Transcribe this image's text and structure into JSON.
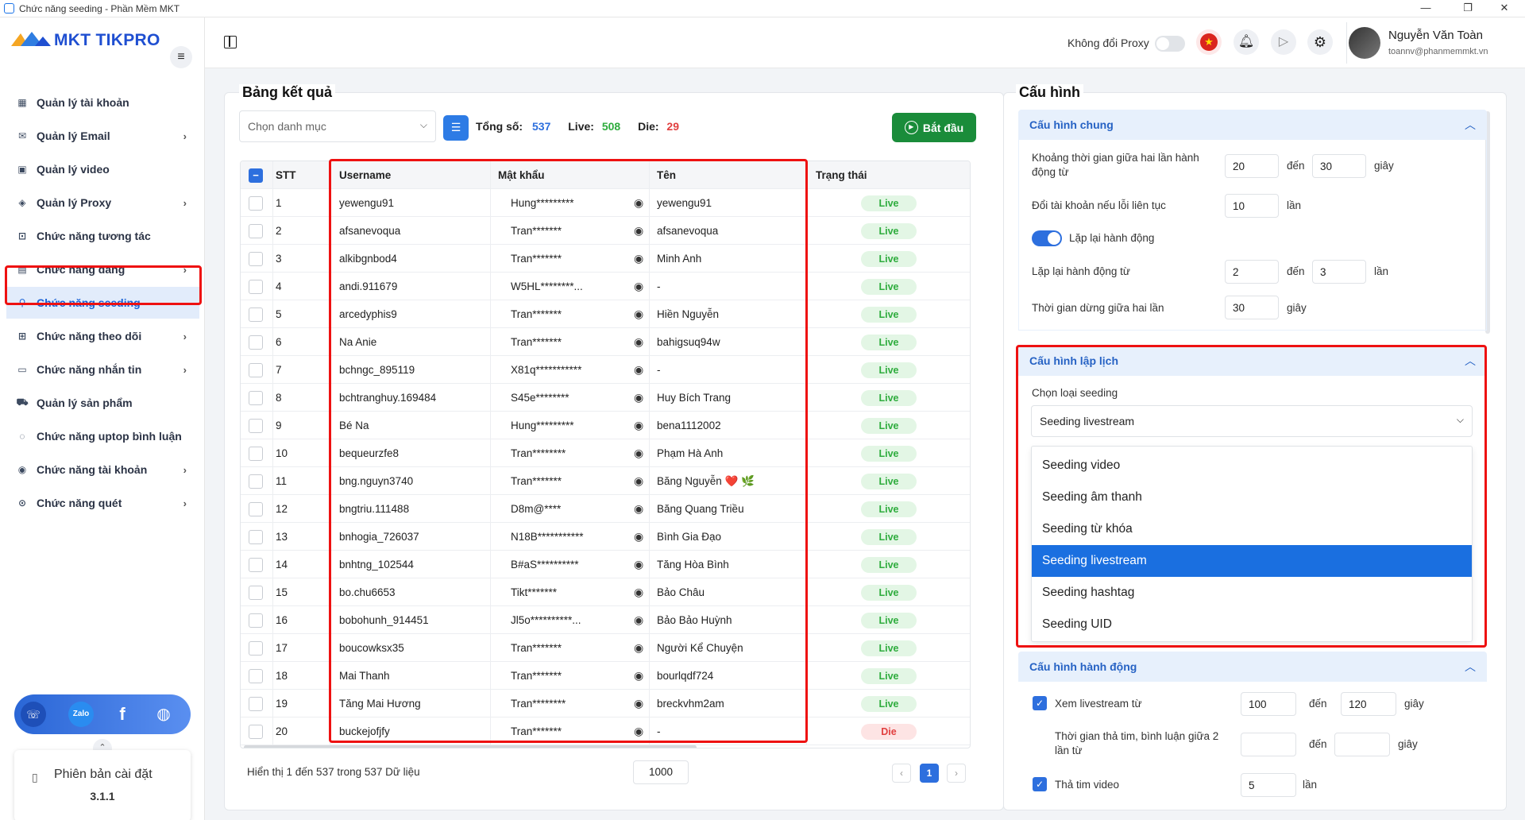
{
  "window": {
    "title": "Chức năng seeding - Phần Mềm MKT",
    "minimize": "—",
    "maximize": "❐",
    "close": "✕"
  },
  "app": {
    "logo_text": "MKT TIKPRO",
    "version_label": "Phiên bản cài đặt",
    "version": "3.1.1"
  },
  "sidebar": {
    "items": [
      {
        "label": "Quản lý tài khoản",
        "icon": "grid-icon",
        "glyph": "▦",
        "chevron": false
      },
      {
        "label": "Quản lý Email",
        "icon": "mail-icon",
        "glyph": "✉",
        "chevron": true
      },
      {
        "label": "Quản lý video",
        "icon": "video-icon",
        "glyph": "▣",
        "chevron": false
      },
      {
        "label": "Quản lý Proxy",
        "icon": "layers-icon",
        "glyph": "◈",
        "chevron": true
      },
      {
        "label": "Chức năng tương tác",
        "icon": "interact-icon",
        "glyph": "⊡",
        "chevron": false
      },
      {
        "label": "Chức năng đăng",
        "icon": "post-icon",
        "glyph": "▤",
        "chevron": true
      },
      {
        "label": "Chức năng seeding",
        "icon": "seeding-icon",
        "glyph": "⚲",
        "chevron": false,
        "active": true
      },
      {
        "label": "Chức năng theo dõi",
        "icon": "follow-icon",
        "glyph": "⊞",
        "chevron": true
      },
      {
        "label": "Chức năng nhắn tin",
        "icon": "message-icon",
        "glyph": "▭",
        "chevron": true
      },
      {
        "label": "Quản lý sản phẩm",
        "icon": "cart-icon",
        "glyph": "⛟",
        "chevron": false
      },
      {
        "label": "Chức năng uptop bình luận",
        "icon": "comment-icon",
        "glyph": "◌",
        "chevron": false
      },
      {
        "label": "Chức năng tài khoản",
        "icon": "user-icon",
        "glyph": "◉",
        "chevron": true
      },
      {
        "label": "Chức năng quét",
        "icon": "scan-icon",
        "glyph": "⊙",
        "chevron": true
      }
    ]
  },
  "header": {
    "proxy_label": "Không đổi Proxy",
    "user_name": "Nguyễn Văn Toàn",
    "user_email": "toannv@phanmemmkt.vn"
  },
  "results": {
    "title": "Bảng kết quả",
    "category_placeholder": "Chọn danh mục",
    "total_label": "Tổng số:",
    "total": "537",
    "live_label": "Live:",
    "live": "508",
    "die_label": "Die:",
    "die": "29",
    "start_button": "Bắt đầu",
    "columns": {
      "stt": "STT",
      "username": "Username",
      "password": "Mật khẩu",
      "name": "Tên",
      "status": "Trạng thái"
    },
    "rows": [
      {
        "stt": "1",
        "username": "yewengu91",
        "password": "Hung*********",
        "name": "yewengu91",
        "status": "Live"
      },
      {
        "stt": "2",
        "username": "afsanevoqua",
        "password": "Tran*******",
        "name": "afsanevoqua",
        "status": "Live"
      },
      {
        "stt": "3",
        "username": "alkibgnbod4",
        "password": "Tran*******",
        "name": "Minh Anh",
        "status": "Live"
      },
      {
        "stt": "4",
        "username": "andi.911679",
        "password": "W5HL********...",
        "name": "-",
        "status": "Live"
      },
      {
        "stt": "5",
        "username": "arcedyphis9",
        "password": "Tran*******",
        "name": "Hiền Nguyễn",
        "status": "Live"
      },
      {
        "stt": "6",
        "username": "Na Anie",
        "password": "Tran*******",
        "name": "bahigsuq94w",
        "status": "Live"
      },
      {
        "stt": "7",
        "username": "bchngc_895119",
        "password": "X81q***********",
        "name": "-",
        "status": "Live"
      },
      {
        "stt": "8",
        "username": "bchtranghuy.169484",
        "password": "S45e********",
        "name": "Huy Bích Trang",
        "status": "Live"
      },
      {
        "stt": "9",
        "username": "Bé Na",
        "password": "Hung*********",
        "name": "bena1112002",
        "status": "Live"
      },
      {
        "stt": "10",
        "username": "bequeurzfe8",
        "password": "Tran********",
        "name": "Phạm Hà Anh",
        "status": "Live"
      },
      {
        "stt": "11",
        "username": "bng.nguyn3740",
        "password": "Tran*******",
        "name": "Băng Nguyễn ❤️ 🌿",
        "status": "Live"
      },
      {
        "stt": "12",
        "username": "bngtriu.111488",
        "password": "D8m@****",
        "name": "Băng Quang Triều",
        "status": "Live"
      },
      {
        "stt": "13",
        "username": "bnhogia_726037",
        "password": "N18B***********",
        "name": "Bình Gia Đạo",
        "status": "Live"
      },
      {
        "stt": "14",
        "username": "bnhtng_102544",
        "password": "B#aS**********",
        "name": "Tăng Hòa Bình",
        "status": "Live"
      },
      {
        "stt": "15",
        "username": "bo.chu6653",
        "password": "Tikt*******",
        "name": "Bảo Châu",
        "status": "Live"
      },
      {
        "stt": "16",
        "username": "bobohunh_914451",
        "password": "Jl5o**********...",
        "name": "Bảo Bảo Huỳnh",
        "status": "Live"
      },
      {
        "stt": "17",
        "username": "boucowksx35",
        "password": "Tran*******",
        "name": "Người Kể Chuyện",
        "status": "Live"
      },
      {
        "stt": "18",
        "username": "Mai Thanh",
        "password": "Tran*******",
        "name": "bourlqdf724",
        "status": "Live"
      },
      {
        "stt": "19",
        "username": "Tăng Mai Hương",
        "password": "Tran********",
        "name": "breckvhm2am",
        "status": "Live"
      },
      {
        "stt": "20",
        "username": "buckejofjfy",
        "password": "Tran*******",
        "name": "-",
        "status": "Die"
      }
    ],
    "footer_text": "Hiển thị 1 đến 537 trong 537 Dữ liệu",
    "page_size": "1000",
    "page": "1",
    "prev": "‹",
    "next": "›"
  },
  "config": {
    "title": "Cấu hình",
    "general": {
      "title": "Cấu hình chung",
      "interval_label": "Khoảng thời gian giữa hai lần hành động từ",
      "interval_from": "20",
      "interval_to": "30",
      "to_word": "đến",
      "seconds_word": "giây",
      "times_word": "lần",
      "switch_label": "Đổi tài khoản nếu lỗi liên tục",
      "switch_value": "10",
      "repeat_toggle_label": "Lặp lại hành động",
      "repeat_label": "Lặp lại hành động từ",
      "repeat_from": "2",
      "repeat_to": "3",
      "pause_label": "Thời gian dừng giữa hai lần",
      "pause_value": "30"
    },
    "schedule": {
      "title": "Cấu hình lập lịch",
      "type_label": "Chọn loại seeding",
      "selected": "Seeding livestream",
      "options": [
        "Seeding video",
        "Seeding âm thanh",
        "Seeding từ khóa",
        "Seeding livestream",
        "Seeding hashtag",
        "Seeding UID"
      ]
    },
    "action": {
      "title": "Cấu hình hành động",
      "watch_label": "Xem livestream từ",
      "watch_from": "100",
      "watch_to": "120",
      "heart_interval_label": "Thời gian thả tim, bình luận giữa 2 lần từ",
      "heart_from": "",
      "heart_to": "",
      "heart_video_label": "Thả tim video",
      "heart_video_value": "5"
    }
  },
  "colors": {
    "accent": "#2d6fde",
    "live": "#2eac3d",
    "die": "#e14040",
    "start": "#1a8c3a",
    "highlight": "#e11111"
  }
}
